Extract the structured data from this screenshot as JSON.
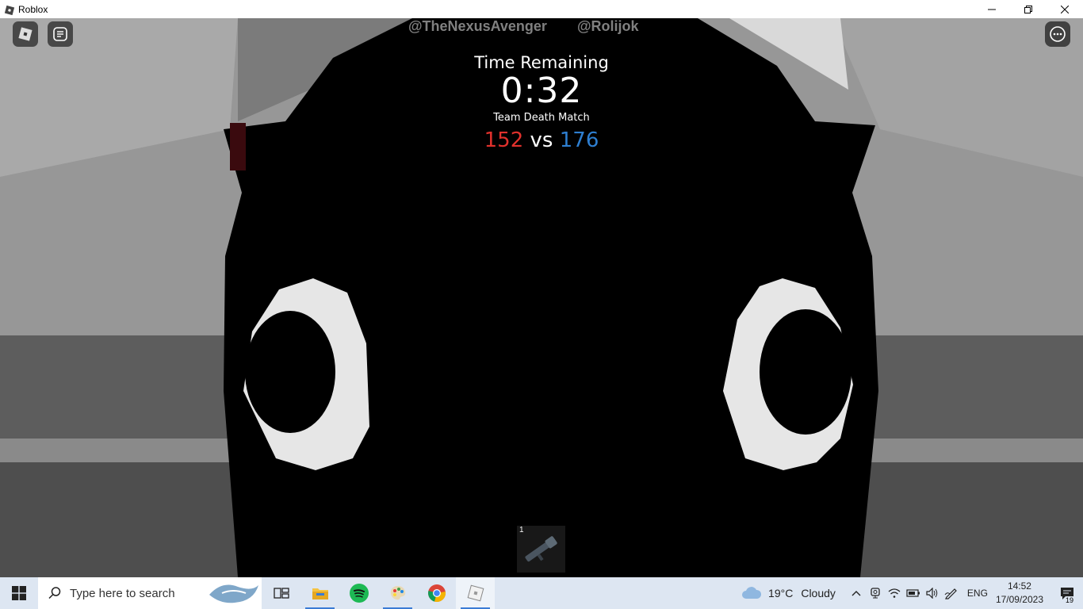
{
  "window": {
    "title": "Roblox",
    "controls": [
      "minimize-icon",
      "restore-icon",
      "close-icon"
    ]
  },
  "overhead_names": [
    "@TheNexusAvenger",
    "@Rolijok"
  ],
  "hud": {
    "time_label": "Time Remaining",
    "time_value": "0:32",
    "mode": "Team Death Match",
    "red_score": "152",
    "vs": "vs",
    "blue_score": "176",
    "colors": {
      "red": "#e0312c",
      "blue": "#2e7fd1"
    }
  },
  "hotbar": {
    "slot_number": "1",
    "item_icon": "rocket-launcher-icon"
  },
  "taskbar": {
    "search_placeholder": "Type here to search",
    "pinned": [
      "task-view-icon",
      "file-explorer-icon",
      "spotify-icon",
      "paint-icon",
      "chrome-icon",
      "roblox-icon"
    ],
    "weather_temp": "19°C",
    "weather_desc": "Cloudy",
    "language": "ENG",
    "time": "14:52",
    "date": "17/09/2023",
    "notification_count": "19"
  }
}
